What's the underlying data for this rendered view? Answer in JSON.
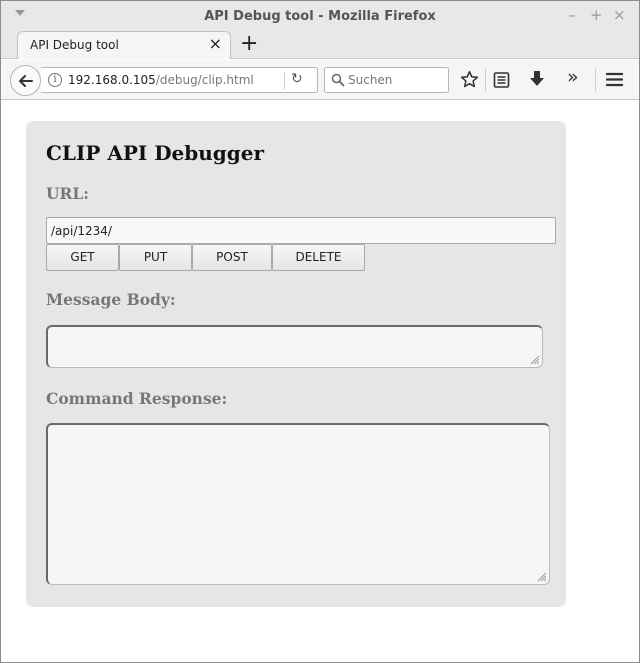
{
  "window": {
    "title": "API Debug tool - Mozilla Firefox",
    "controls": {
      "minimize": "–",
      "maximize": "+",
      "close": "×"
    }
  },
  "tabs": [
    {
      "label": "API Debug tool",
      "close": "×"
    }
  ],
  "new_tab": "+",
  "toolbar": {
    "url_host": "192.168.0.105",
    "url_path": "/debug/clip.html",
    "info_glyph": "i",
    "reload_glyph": "↻",
    "search_placeholder": "Suchen",
    "overflow_glyph": "»"
  },
  "page": {
    "heading": "CLIP API Debugger",
    "url_label": "URL:",
    "url_value": "/api/1234/",
    "buttons": [
      "GET",
      "PUT",
      "POST",
      "DELETE"
    ],
    "body_label": "Message Body:",
    "body_value": "",
    "response_label": "Command Response:",
    "response_value": ""
  },
  "icons": {
    "back": "back-arrow-icon",
    "info": "info-icon",
    "reload": "reload-icon",
    "search": "search-icon",
    "bookmark": "star-icon",
    "library": "library-icon",
    "downloads": "download-icon",
    "overflow": "overflow-icon",
    "menu": "hamburger-menu-icon"
  }
}
